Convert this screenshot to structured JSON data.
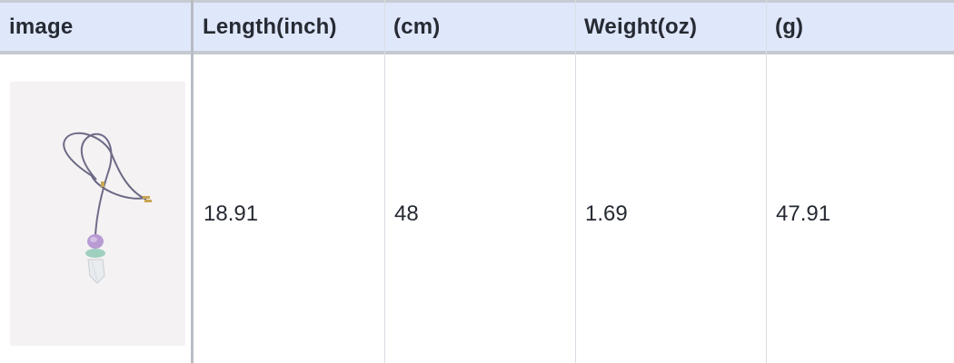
{
  "table": {
    "columns": [
      "image",
      "Length(inch)",
      "(cm)",
      "Weight(oz)",
      "(g)"
    ],
    "rows": [
      {
        "image_alt": "necklace-photo",
        "length_inch": "18.91",
        "length_cm": "48",
        "weight_oz": "1.69",
        "weight_g": "47.91"
      }
    ]
  }
}
